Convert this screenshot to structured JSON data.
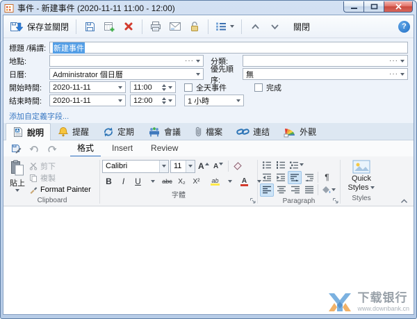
{
  "window": {
    "title": "事件 - 新建事件 (2020-11-11 11:00 - 12:00)"
  },
  "toolbar": {
    "save_and_close_label": "保存並關閉",
    "close_label": "關閉"
  },
  "form": {
    "title": {
      "label": "標題 /稱謂:",
      "value": "新建事件"
    },
    "location": {
      "label": "地點:",
      "value": ""
    },
    "category": {
      "label": "分類:",
      "value": ""
    },
    "calendar": {
      "label": "日曆:",
      "value": "Administrator 個日曆"
    },
    "priority": {
      "label": "優先順序:",
      "value": "無"
    },
    "start": {
      "label": "開始時間:",
      "date": "2020-11-11",
      "time": "11:00"
    },
    "end": {
      "label": "结束時間:",
      "date": "2020-11-11",
      "time": "12:00"
    },
    "all_day": {
      "label": "全天事件",
      "checked": false
    },
    "complete": {
      "label": "完成",
      "checked": false
    },
    "duration": {
      "value": "1 小時"
    },
    "add_custom_field": "添加自定義字段..."
  },
  "section_tabs": [
    {
      "label": "說明",
      "icon": "document-icon",
      "active": true
    },
    {
      "label": "提醒",
      "icon": "bell-icon",
      "active": false
    },
    {
      "label": "定期",
      "icon": "recurrence-icon",
      "active": false
    },
    {
      "label": "會議",
      "icon": "meeting-icon",
      "active": false
    },
    {
      "label": "檔案",
      "icon": "paperclip-icon",
      "active": false
    },
    {
      "label": "連结",
      "icon": "link-icon",
      "active": false
    },
    {
      "label": "外觀",
      "icon": "palette-icon",
      "active": false
    }
  ],
  "ribbon": {
    "tabs": [
      {
        "label": "格式",
        "active": true
      },
      {
        "label": "Insert",
        "active": false
      },
      {
        "label": "Review",
        "active": false
      }
    ],
    "clipboard": {
      "paste": "貼上",
      "cut": "剪下",
      "copy": "複製",
      "format_painter": "Format Painter",
      "group_label": "Clipboard"
    },
    "font": {
      "family": "Calibri",
      "size": "11",
      "group_label": "字體"
    },
    "paragraph": {
      "group_label": "Paragraph"
    },
    "styles": {
      "quick_styles_line1": "Quick",
      "quick_styles_line2": "Styles",
      "group_label": "Styles"
    }
  },
  "glyphs": {
    "ellipsis": "···",
    "pilcrow": "¶",
    "bold": "B",
    "italic": "I",
    "underline": "U",
    "strikethrough": "abc",
    "subscript": "X₂",
    "superscript": "X²",
    "grow_font": "A",
    "shrink_font": "A",
    "highlight": "ab",
    "font_color": "A",
    "help": "?"
  },
  "watermark": {
    "name": "下载银行",
    "url": "www.downbank.cn"
  },
  "colors": {
    "accent_blue": "#2a6dbf",
    "selection_blue": "#539ee6",
    "close_red": "#c94a3e",
    "link_blue": "#3a79c3",
    "highlight_yellow": "#ffe94a",
    "font_color_red": "#d23b2e"
  }
}
